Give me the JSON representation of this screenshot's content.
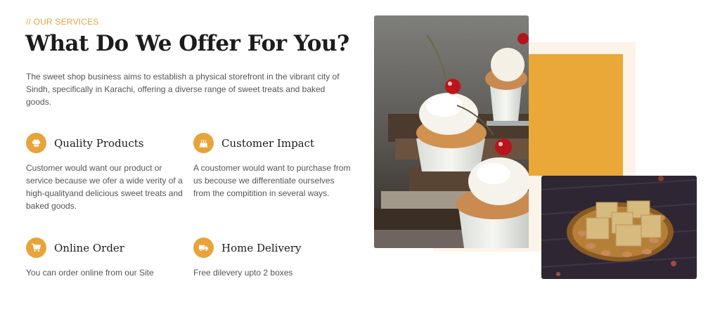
{
  "section": {
    "tag": "// OUR SERVICES",
    "title": "What Do We Offer For You?",
    "intro": "The sweet shop business aims to establish a physical storefront in the vibrant city of Sindh, specifically in Karachi, offering a diverse range of sweet treats and baked goods."
  },
  "features": [
    {
      "icon": "chef-hat-icon",
      "title": "Quality Products",
      "text": "Customer would want our product or service because we ofer a wide verity of a high-qualityand delicious sweet treats and baked goods."
    },
    {
      "icon": "birthday-cake-icon",
      "title": "Customer Impact",
      "text": "A coustomer would want to purchase from us becouse we differentiate ourselves from the compitition in several ways."
    },
    {
      "icon": "shopping-cart-icon",
      "title": "Online Order",
      "text": "You can order online from our Site"
    },
    {
      "icon": "delivery-truck-icon",
      "title": "Home Delivery",
      "text": "Free dilevery upto 2 boxes"
    }
  ],
  "colors": {
    "accent": "#e8a33a",
    "heading": "#1c1c1c",
    "body_text": "#555555",
    "cream": "#fcf3e9"
  }
}
